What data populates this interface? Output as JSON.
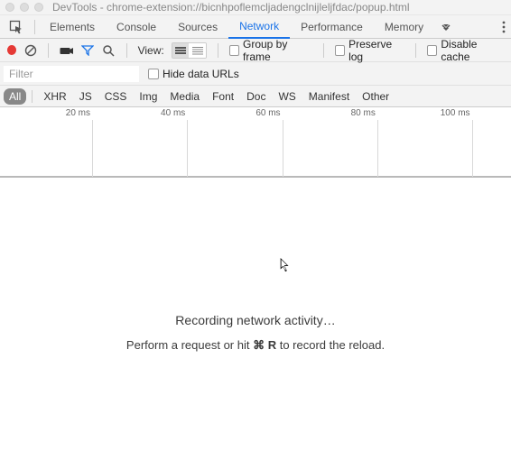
{
  "titlebar": {
    "title": "DevTools - chrome-extension://bicnhpoflemcljadengclnijleljfdac/popup.html"
  },
  "tabs": {
    "items": [
      "Elements",
      "Console",
      "Sources",
      "Network",
      "Performance",
      "Memory"
    ],
    "active": "Network"
  },
  "toolbar": {
    "view_label": "View:",
    "group_by_frame": "Group by frame",
    "preserve_log": "Preserve log",
    "disable_cache": "Disable cache"
  },
  "filter": {
    "placeholder": "Filter",
    "hide_data_urls": "Hide data URLs"
  },
  "type_filters": [
    "All",
    "XHR",
    "JS",
    "CSS",
    "Img",
    "Media",
    "Font",
    "Doc",
    "WS",
    "Manifest",
    "Other"
  ],
  "timeline": {
    "ticks": [
      "20 ms",
      "40 ms",
      "60 ms",
      "80 ms",
      "100 ms"
    ]
  },
  "empty": {
    "line1": "Recording network activity…",
    "line2a": "Perform a request or hit ",
    "kbd1": "⌘",
    "kbd2": "R",
    "line2b": " to record the reload."
  }
}
